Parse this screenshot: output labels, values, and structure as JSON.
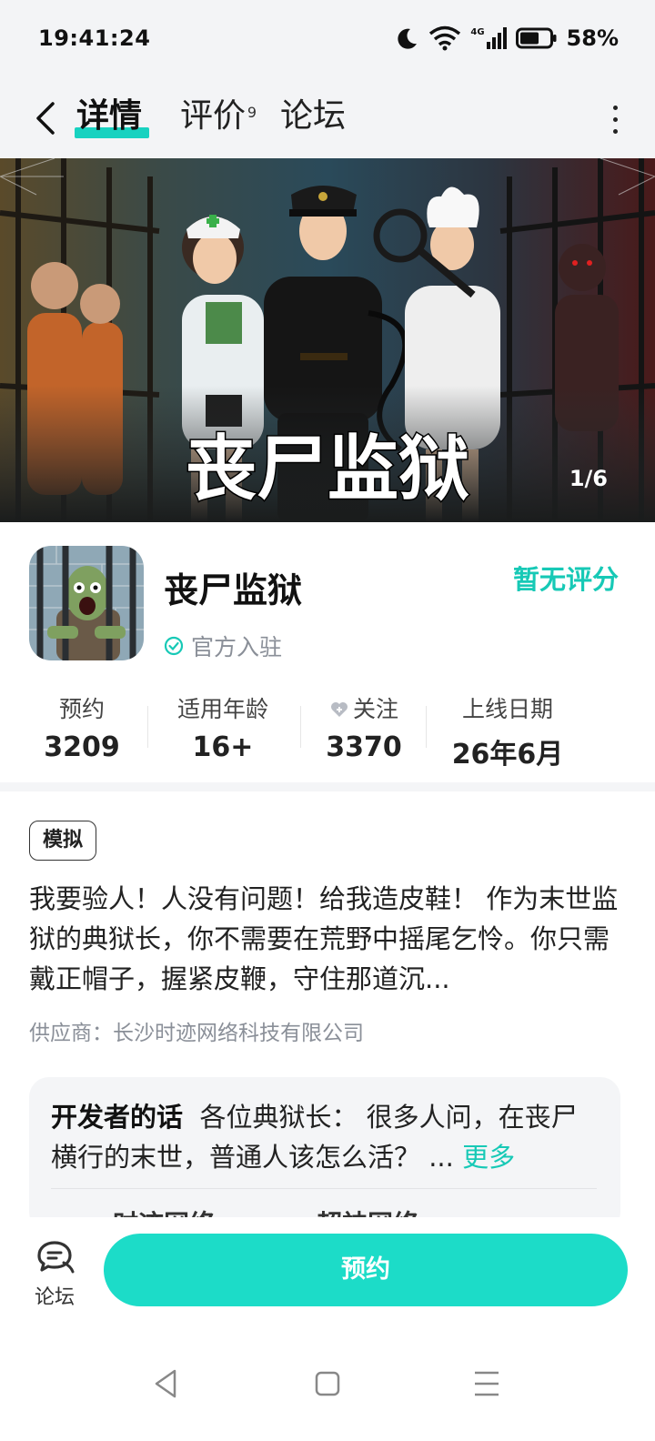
{
  "status_bar": {
    "time": "19:41:24",
    "battery": "58%",
    "network": "4G"
  },
  "nav": {
    "tabs": [
      {
        "label": "详情",
        "active": true
      },
      {
        "label": "评价",
        "badge": "9"
      },
      {
        "label": "论坛"
      }
    ]
  },
  "banner": {
    "title": "丧尸监狱",
    "counter": "1/6"
  },
  "app": {
    "name": "丧尸监狱",
    "official_label": "官方入驻",
    "rating": "暂无评分"
  },
  "stats": [
    {
      "label": "预约",
      "value": "3209"
    },
    {
      "label": "适用年龄",
      "value": "16+"
    },
    {
      "label": "关注",
      "value": "3370",
      "icon": "heart-plus-icon"
    },
    {
      "label": "上线日期",
      "value": "26年6月"
    }
  ],
  "tag": "模拟",
  "description": "我要验人！人没有问题！给我造皮鞋！ 作为末世监狱的典狱长，你不需要在荒野中摇尾乞怜。你只需戴正帽子，握紧皮鞭，守住那道沉...",
  "supplier": "供应商：长沙时迹网络科技有限公司",
  "developer_note": {
    "heading": "开发者的话",
    "text": "各位典狱长： 很多人问，在丧尸横行的末世，普通人该怎么活？ ...",
    "more": "更多",
    "partial_items": [
      "时迹网络",
      "超神网络"
    ]
  },
  "bottom": {
    "forum_label": "论坛",
    "reserve_label": "预约"
  },
  "colors": {
    "accent": "#1cdcc8",
    "accent_text": "#17c9b6"
  }
}
